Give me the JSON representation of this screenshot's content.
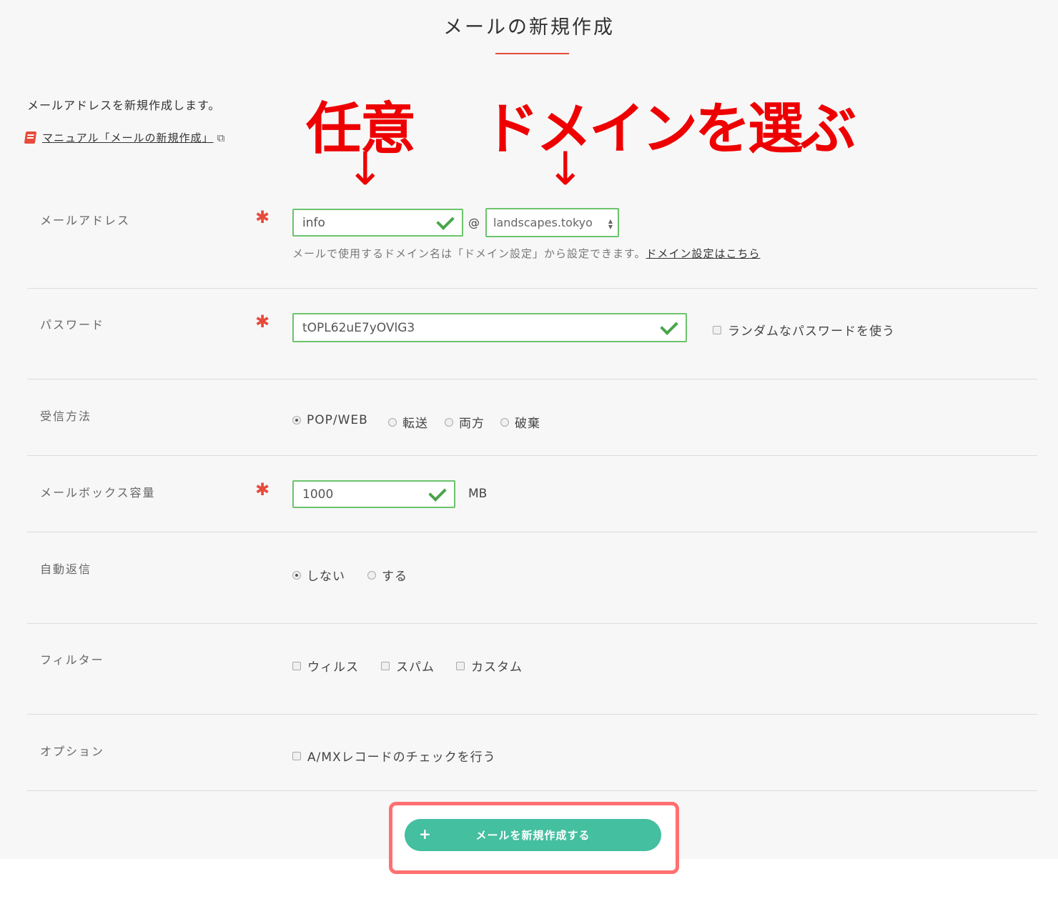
{
  "header": {
    "title": "メールの新規作成"
  },
  "intro": {
    "text": "メールアドレスを新規作成します。",
    "manual_link": "マニュアル「メールの新規作成」"
  },
  "annotations": {
    "optional": "任意",
    "choose_domain": "ドメインを選ぶ",
    "arrow": "↓"
  },
  "form": {
    "required_mark": "✱",
    "email": {
      "label": "メールアドレス",
      "local_value": "info",
      "at": "@",
      "domain_selected": "landscapes.tokyo",
      "help_text": "メールで使用するドメイン名は「ドメイン設定」から設定できます。",
      "help_link": "ドメイン設定はこちら"
    },
    "password": {
      "label": "パスワード",
      "value": "tOPL62uE7yOVlG3",
      "random_label": "ランダムなパスワードを使う"
    },
    "receive": {
      "label": "受信方法",
      "options": [
        "POP/WEB",
        "転送",
        "両方",
        "破棄"
      ],
      "selected": "POP/WEB"
    },
    "mailbox": {
      "label": "メールボックス容量",
      "value": "1000",
      "unit": "MB"
    },
    "autoreply": {
      "label": "自動返信",
      "options": [
        "しない",
        "する"
      ],
      "selected": "しない"
    },
    "filter": {
      "label": "フィルター",
      "options": [
        "ウィルス",
        "スパム",
        "カスタム"
      ]
    },
    "option": {
      "label": "オプション",
      "options": [
        "A/MXレコードのチェックを行う"
      ]
    }
  },
  "submit": {
    "label": "メールを新規作成する",
    "plus": "+"
  },
  "colors": {
    "accent": "#e64b3b",
    "valid_border": "#6cc36c",
    "button": "#44bfa0",
    "annotation": "#ee0000",
    "highlight": "#ff7070"
  }
}
